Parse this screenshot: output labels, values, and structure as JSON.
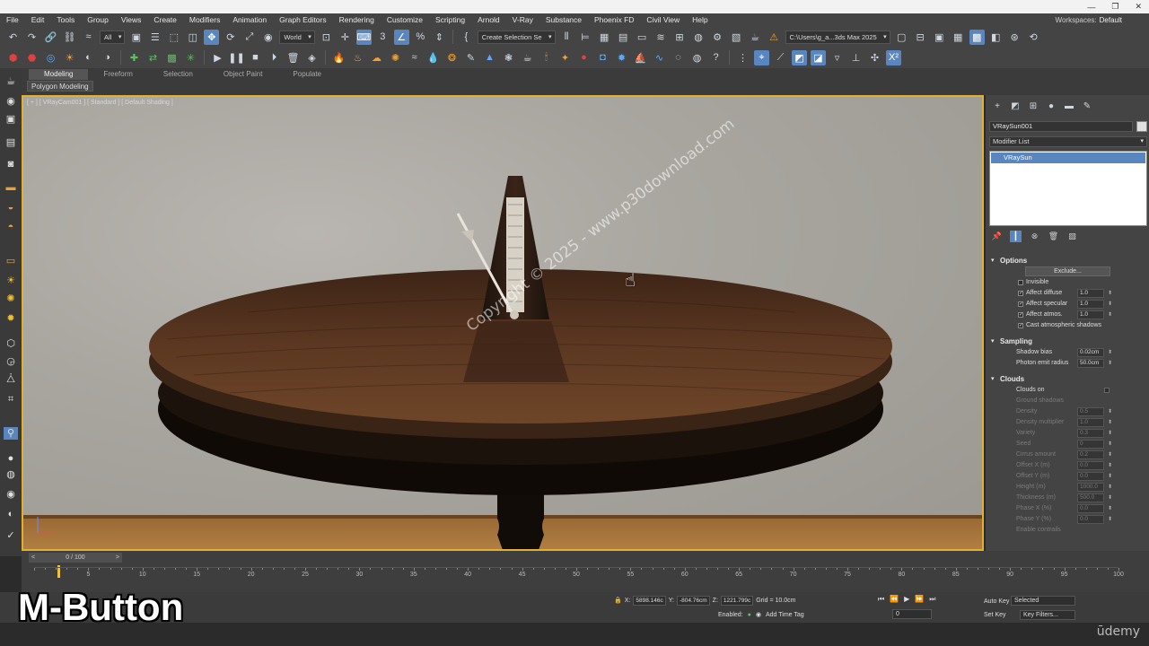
{
  "menubar": {
    "items": [
      "File",
      "Edit",
      "Tools",
      "Group",
      "Views",
      "Create",
      "Modifiers",
      "Animation",
      "Graph Editors",
      "Rendering",
      "Customize",
      "Scripting",
      "Arnold",
      "V-Ray",
      "Substance",
      "Phoenix FD",
      "Civil View",
      "Help"
    ],
    "workspaces_label": "Workspaces:",
    "workspaces_value": "Default"
  },
  "toolbar": {
    "selection_filter": "All",
    "ref_coord": "World",
    "named_selection": "Create Selection Se",
    "project_path": "C:\\Users\\g_a...3ds Max 2025"
  },
  "ribbon": {
    "tabs": [
      "Modeling",
      "Freeform",
      "Selection",
      "Object Paint",
      "Populate"
    ],
    "active_tab": "Modeling",
    "sub_label": "Polygon Modeling"
  },
  "viewport": {
    "label": "[ + ] [ VRayCam001 ] [ Standard ] [ Default Shading ]",
    "watermark": "Copyright © 2025 - www.p30download.com"
  },
  "command_panel": {
    "object_name": "VRaySun001",
    "modifier_list": "Modifier List",
    "stack_item": "VRaySun",
    "options": {
      "title": "Options",
      "exclude_button": "Exclude...",
      "invisible": "Invisible",
      "affect_diffuse": {
        "label": "Affect diffuse",
        "value": "1.0"
      },
      "affect_specular": {
        "label": "Affect specular",
        "value": "1.0"
      },
      "affect_atmos": {
        "label": "Affect atmos.",
        "value": "1.0"
      },
      "cast_atmospheric": "Cast atmospheric shadows"
    },
    "sampling": {
      "title": "Sampling",
      "shadow_bias": {
        "label": "Shadow bias",
        "value": "0.02cm"
      },
      "photon_radius": {
        "label": "Photon emit radius",
        "value": "50.0cm"
      }
    },
    "clouds": {
      "title": "Clouds",
      "clouds_on": "Clouds on",
      "ground_shadows": "Ground shadows",
      "rows": [
        {
          "label": "Density",
          "value": "0.5"
        },
        {
          "label": "Density multiplier",
          "value": "1.0"
        },
        {
          "label": "Variety",
          "value": "0.3"
        },
        {
          "label": "Seed",
          "value": "0"
        },
        {
          "label": "Cirrus amount",
          "value": "0.2"
        },
        {
          "label": "Offset X (m)",
          "value": "0.0"
        },
        {
          "label": "Offset Y (m)",
          "value": "0.0"
        },
        {
          "label": "Height (m)",
          "value": "1000.0"
        },
        {
          "label": "Thickness (m)",
          "value": "500.0"
        },
        {
          "label": "Phase X (%)",
          "value": "0.0"
        },
        {
          "label": "Phase Y (%)",
          "value": "0.0"
        }
      ],
      "enable_contrails": "Enable contrails"
    }
  },
  "timeline": {
    "slider_label": "0 / 100",
    "ticks": [
      "0",
      "5",
      "10",
      "15",
      "20",
      "25",
      "30",
      "35",
      "40",
      "45",
      "50",
      "55",
      "60",
      "65",
      "70",
      "75",
      "80",
      "85",
      "90",
      "95",
      "100"
    ]
  },
  "status": {
    "x_label": "X:",
    "x_value": "5898.146c",
    "y_label": "Y:",
    "y_value": "-804.76cm",
    "z_label": "Z:",
    "z_value": "1221.799c",
    "grid": "Grid = 10.0cm",
    "enabled": "Enabled:",
    "add_time_tag": "Add Time Tag",
    "frame_value": "0",
    "auto_key": "Auto Key",
    "set_key": "Set Key",
    "key_mode": "Selected",
    "key_filters": "Key Filters..."
  },
  "caption": "M-Button",
  "brand": "ūdemy",
  "colors": {
    "viewport_border": "#e0b030",
    "active_blue": "#5a86c0",
    "table_wood": "#5a3520"
  }
}
